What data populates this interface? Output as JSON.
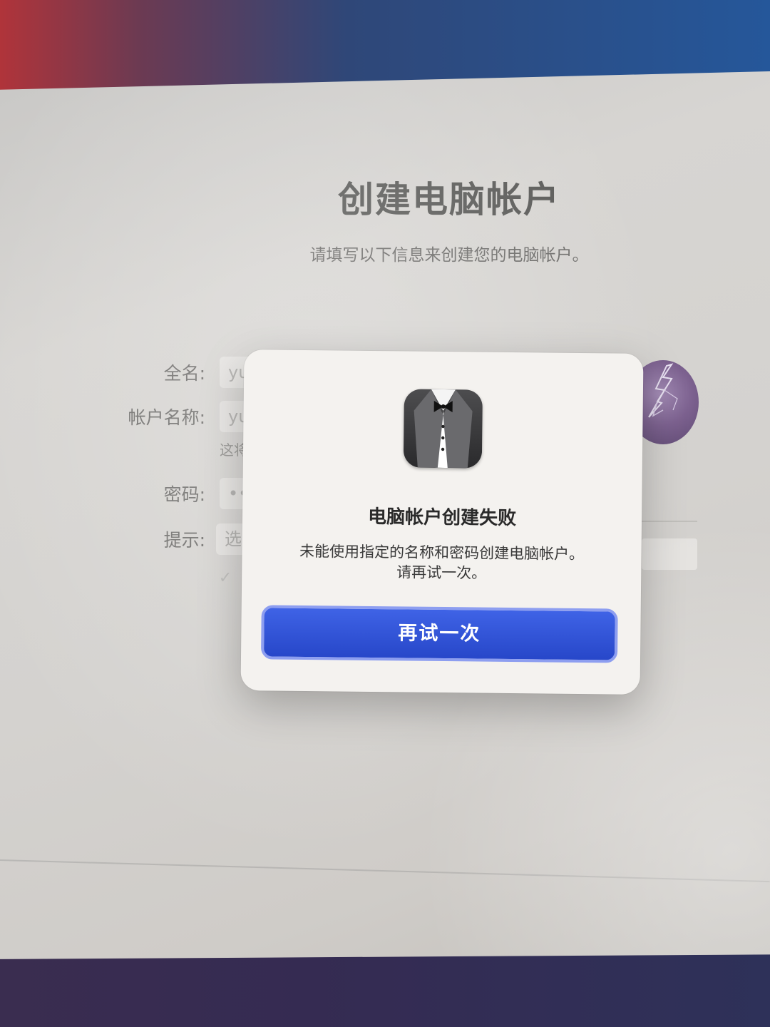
{
  "setup": {
    "title": "创建电脑帐户",
    "subtitle": "请填写以下信息来创建您的电脑帐户。",
    "labels": {
      "full_name": "全名:",
      "account_name": "帐户名称:",
      "password": "密码:",
      "hint": "提示:"
    },
    "values": {
      "full_name": "yu",
      "account_name": "yu",
      "account_note": "这将",
      "password_mask": "••",
      "hint_placeholder": "选"
    }
  },
  "dialog": {
    "app_icon": "butler-tuxedo-icon",
    "title": "电脑帐户创建失败",
    "message_line1": "未能使用指定的名称和密码创建电脑帐户。",
    "message_line2": "请再试一次。",
    "button_label": "再试一次"
  },
  "colors": {
    "button": "#2f52d8",
    "dialog_bg": "#f4f2ef",
    "avatar": "#7d6290"
  }
}
